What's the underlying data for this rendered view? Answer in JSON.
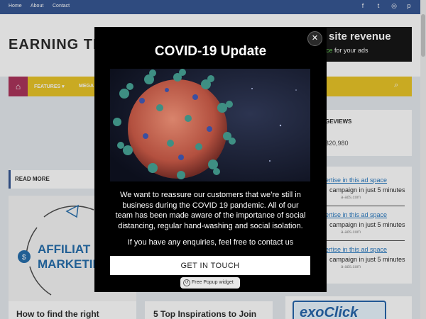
{
  "topnav": {
    "items": [
      "Home",
      "About",
      "Contact"
    ]
  },
  "social": [
    "f",
    "t",
    "◎",
    "p"
  ],
  "site": {
    "logo": "EARNING TI"
  },
  "header_ad": {
    "line1": "site revenue",
    "line2_highlight": "ce",
    "line2_rest": " for your ads"
  },
  "nav": {
    "home_icon": "⌂",
    "features": "FEATURES ▾",
    "mega": "MEGA",
    "search_icon": "⌕"
  },
  "content": {
    "read_more": "READ MORE",
    "affiliate_line1": "AFFILIAT",
    "affiliate_line2": "MARKETIN",
    "card1_title": "How to find the right",
    "card2_title": "5 Top Inspirations to Join"
  },
  "sidebar": {
    "pageviews_heading": "GEVIEWS",
    "pageviews_count": "320,980",
    "ads": [
      {
        "link": "ertise in this ad space",
        "desc": "campaign in just 5 minutes",
        "src": "a-ads.com"
      },
      {
        "link": "ertise in this ad space",
        "desc": "campaign in just 5 minutes",
        "src": "a-ads.com"
      },
      {
        "link": "ertise in this ad space",
        "desc": "campaign in just 5 minutes",
        "src": "a-ads.com"
      }
    ],
    "exoclick": "exoClick"
  },
  "popup": {
    "close": "✕",
    "title": "COVID-19 Update",
    "body": "We want to reassure our customers that we’re still in business during the COVID 19 pandemic. All of our team has been made aware of the importance of social distancing, regular hand-washing and social isolation.",
    "contact": "If you have any enquiries, feel free to contact us",
    "cta": "GET IN TOUCH",
    "widget_label": "Free Popup widget"
  }
}
